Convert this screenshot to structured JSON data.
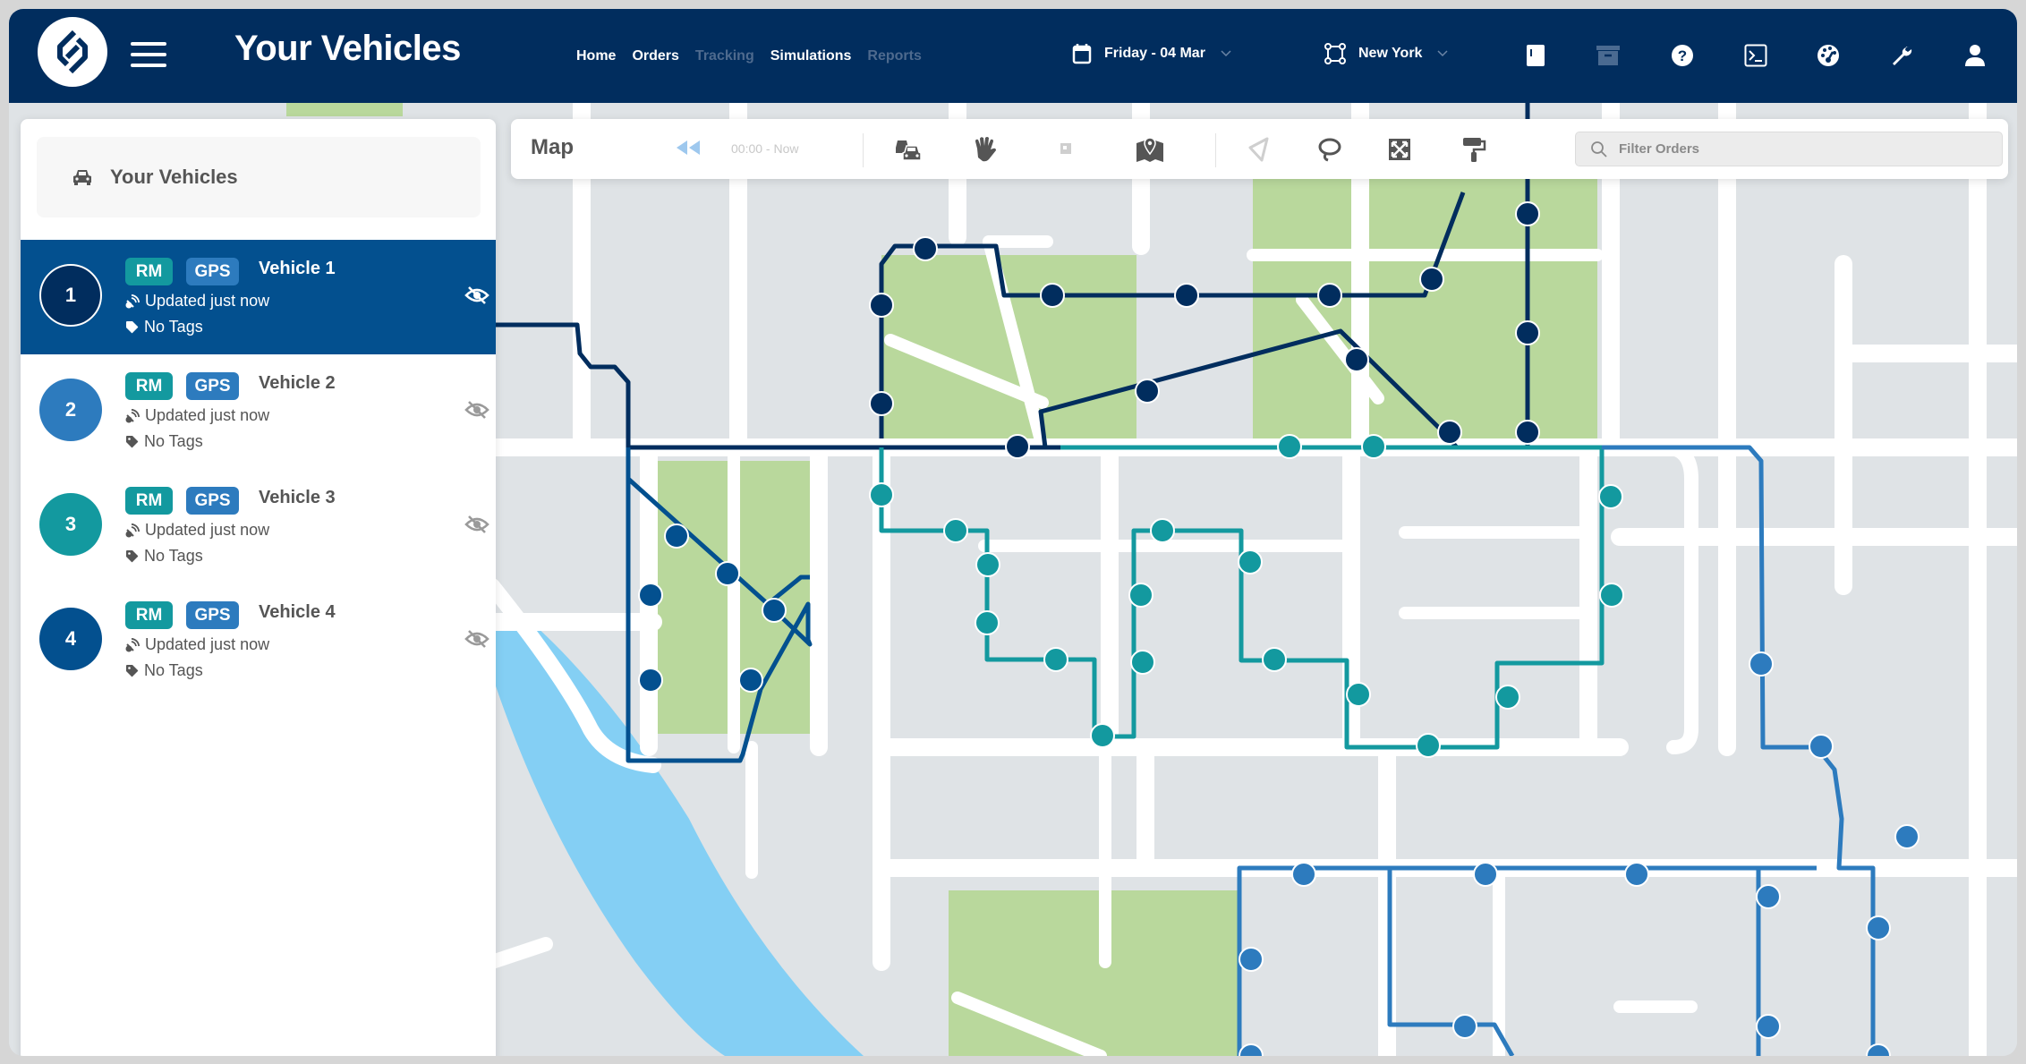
{
  "header": {
    "title": "Your Vehicles",
    "nav": [
      {
        "label": "Home",
        "active": true
      },
      {
        "label": "Orders",
        "active": true
      },
      {
        "label": "Tracking",
        "active": false
      },
      {
        "label": "Simulations",
        "active": true
      },
      {
        "label": "Reports",
        "active": false
      }
    ],
    "date_picker": {
      "icon": "calendar-icon",
      "label": "Friday - 04 Mar"
    },
    "region_picker": {
      "icon": "area-select-icon",
      "label": "New York"
    },
    "icons": [
      "notebook-icon",
      "archive-icon",
      "help-icon",
      "terminal-icon",
      "dashboard-gauge-icon",
      "wrench-icon",
      "user-icon"
    ]
  },
  "sidebar": {
    "title": "Your Vehicles",
    "vehicles": [
      {
        "number": "1",
        "name": "Vehicle 1",
        "badges": [
          "RM",
          "GPS"
        ],
        "updated": "Updated just now",
        "tags": "No Tags",
        "selected": true,
        "color": "#012d5e"
      },
      {
        "number": "2",
        "name": "Vehicle 2",
        "badges": [
          "RM",
          "GPS"
        ],
        "updated": "Updated just now",
        "tags": "No Tags",
        "selected": false,
        "color": "#2d7bbe"
      },
      {
        "number": "3",
        "name": "Vehicle 3",
        "badges": [
          "RM",
          "GPS"
        ],
        "updated": "Updated just now",
        "tags": "No Tags",
        "selected": false,
        "color": "#13999f"
      },
      {
        "number": "4",
        "name": "Vehicle 4",
        "badges": [
          "RM",
          "GPS"
        ],
        "updated": "Updated just now",
        "tags": "No Tags",
        "selected": false,
        "color": "#03508f"
      }
    ]
  },
  "toolbar": {
    "title": "Map",
    "time_range": "00:00 - Now",
    "tools": [
      "traffic-icon",
      "hand-pan-icon",
      "small-marker-icon",
      "map-pin-icon",
      "polygon-select-icon",
      "lasso-icon",
      "expand-icon",
      "paint-roller-icon"
    ],
    "filter_placeholder": "Filter Orders"
  },
  "colors": {
    "header_bg": "#012d5e",
    "selected_row": "#03508f",
    "route_vehicle_1": "#012d5e",
    "route_vehicle_2": "#2d7bbe",
    "route_vehicle_3": "#13999f",
    "route_vehicle_4": "#03508f",
    "park": "#b9d89c",
    "water": "#84cff4",
    "block": "#dfe3e6"
  }
}
